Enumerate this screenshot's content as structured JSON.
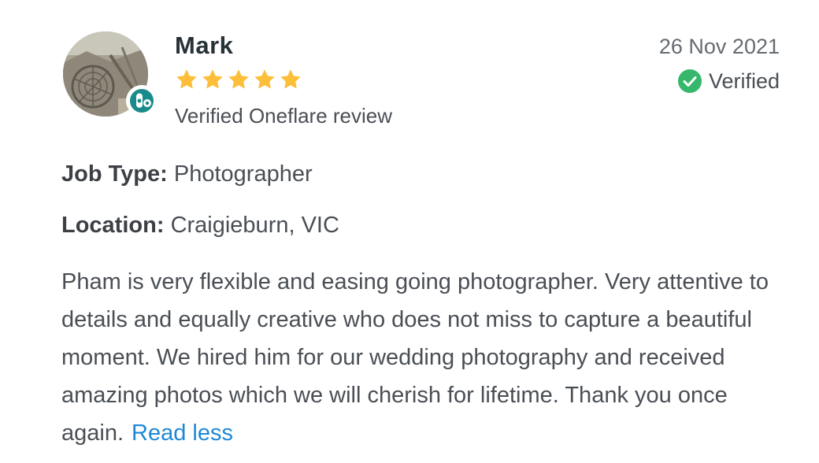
{
  "review": {
    "reviewer_name": "Mark",
    "rating": 5,
    "rating_max": 5,
    "subtitle": "Verified Oneflare review",
    "date": "26 Nov 2021",
    "verified_label": "Verified",
    "job_type_label": "Job Type:",
    "job_type_value": "Photographer",
    "location_label": "Location:",
    "location_value": "Craigieburn, VIC",
    "body": "Pham is very flexible and easing going photographer. Very attentive to details and equally creative who does not miss to capture a beautiful moment. We hired him for our wedding photography and received amazing photos which we will cherish for lifetime. Thank you once again.",
    "read_less_label": "Read less"
  },
  "colors": {
    "star": "#fdbf3a",
    "verified_check": "#35b86b",
    "brand_badge": "#1a8a8a",
    "link": "#1e88d6"
  },
  "icons": {
    "avatar": "profile-photo",
    "badge": "oneflare-logo-icon",
    "star": "star-icon",
    "verified": "check-circle-icon"
  }
}
